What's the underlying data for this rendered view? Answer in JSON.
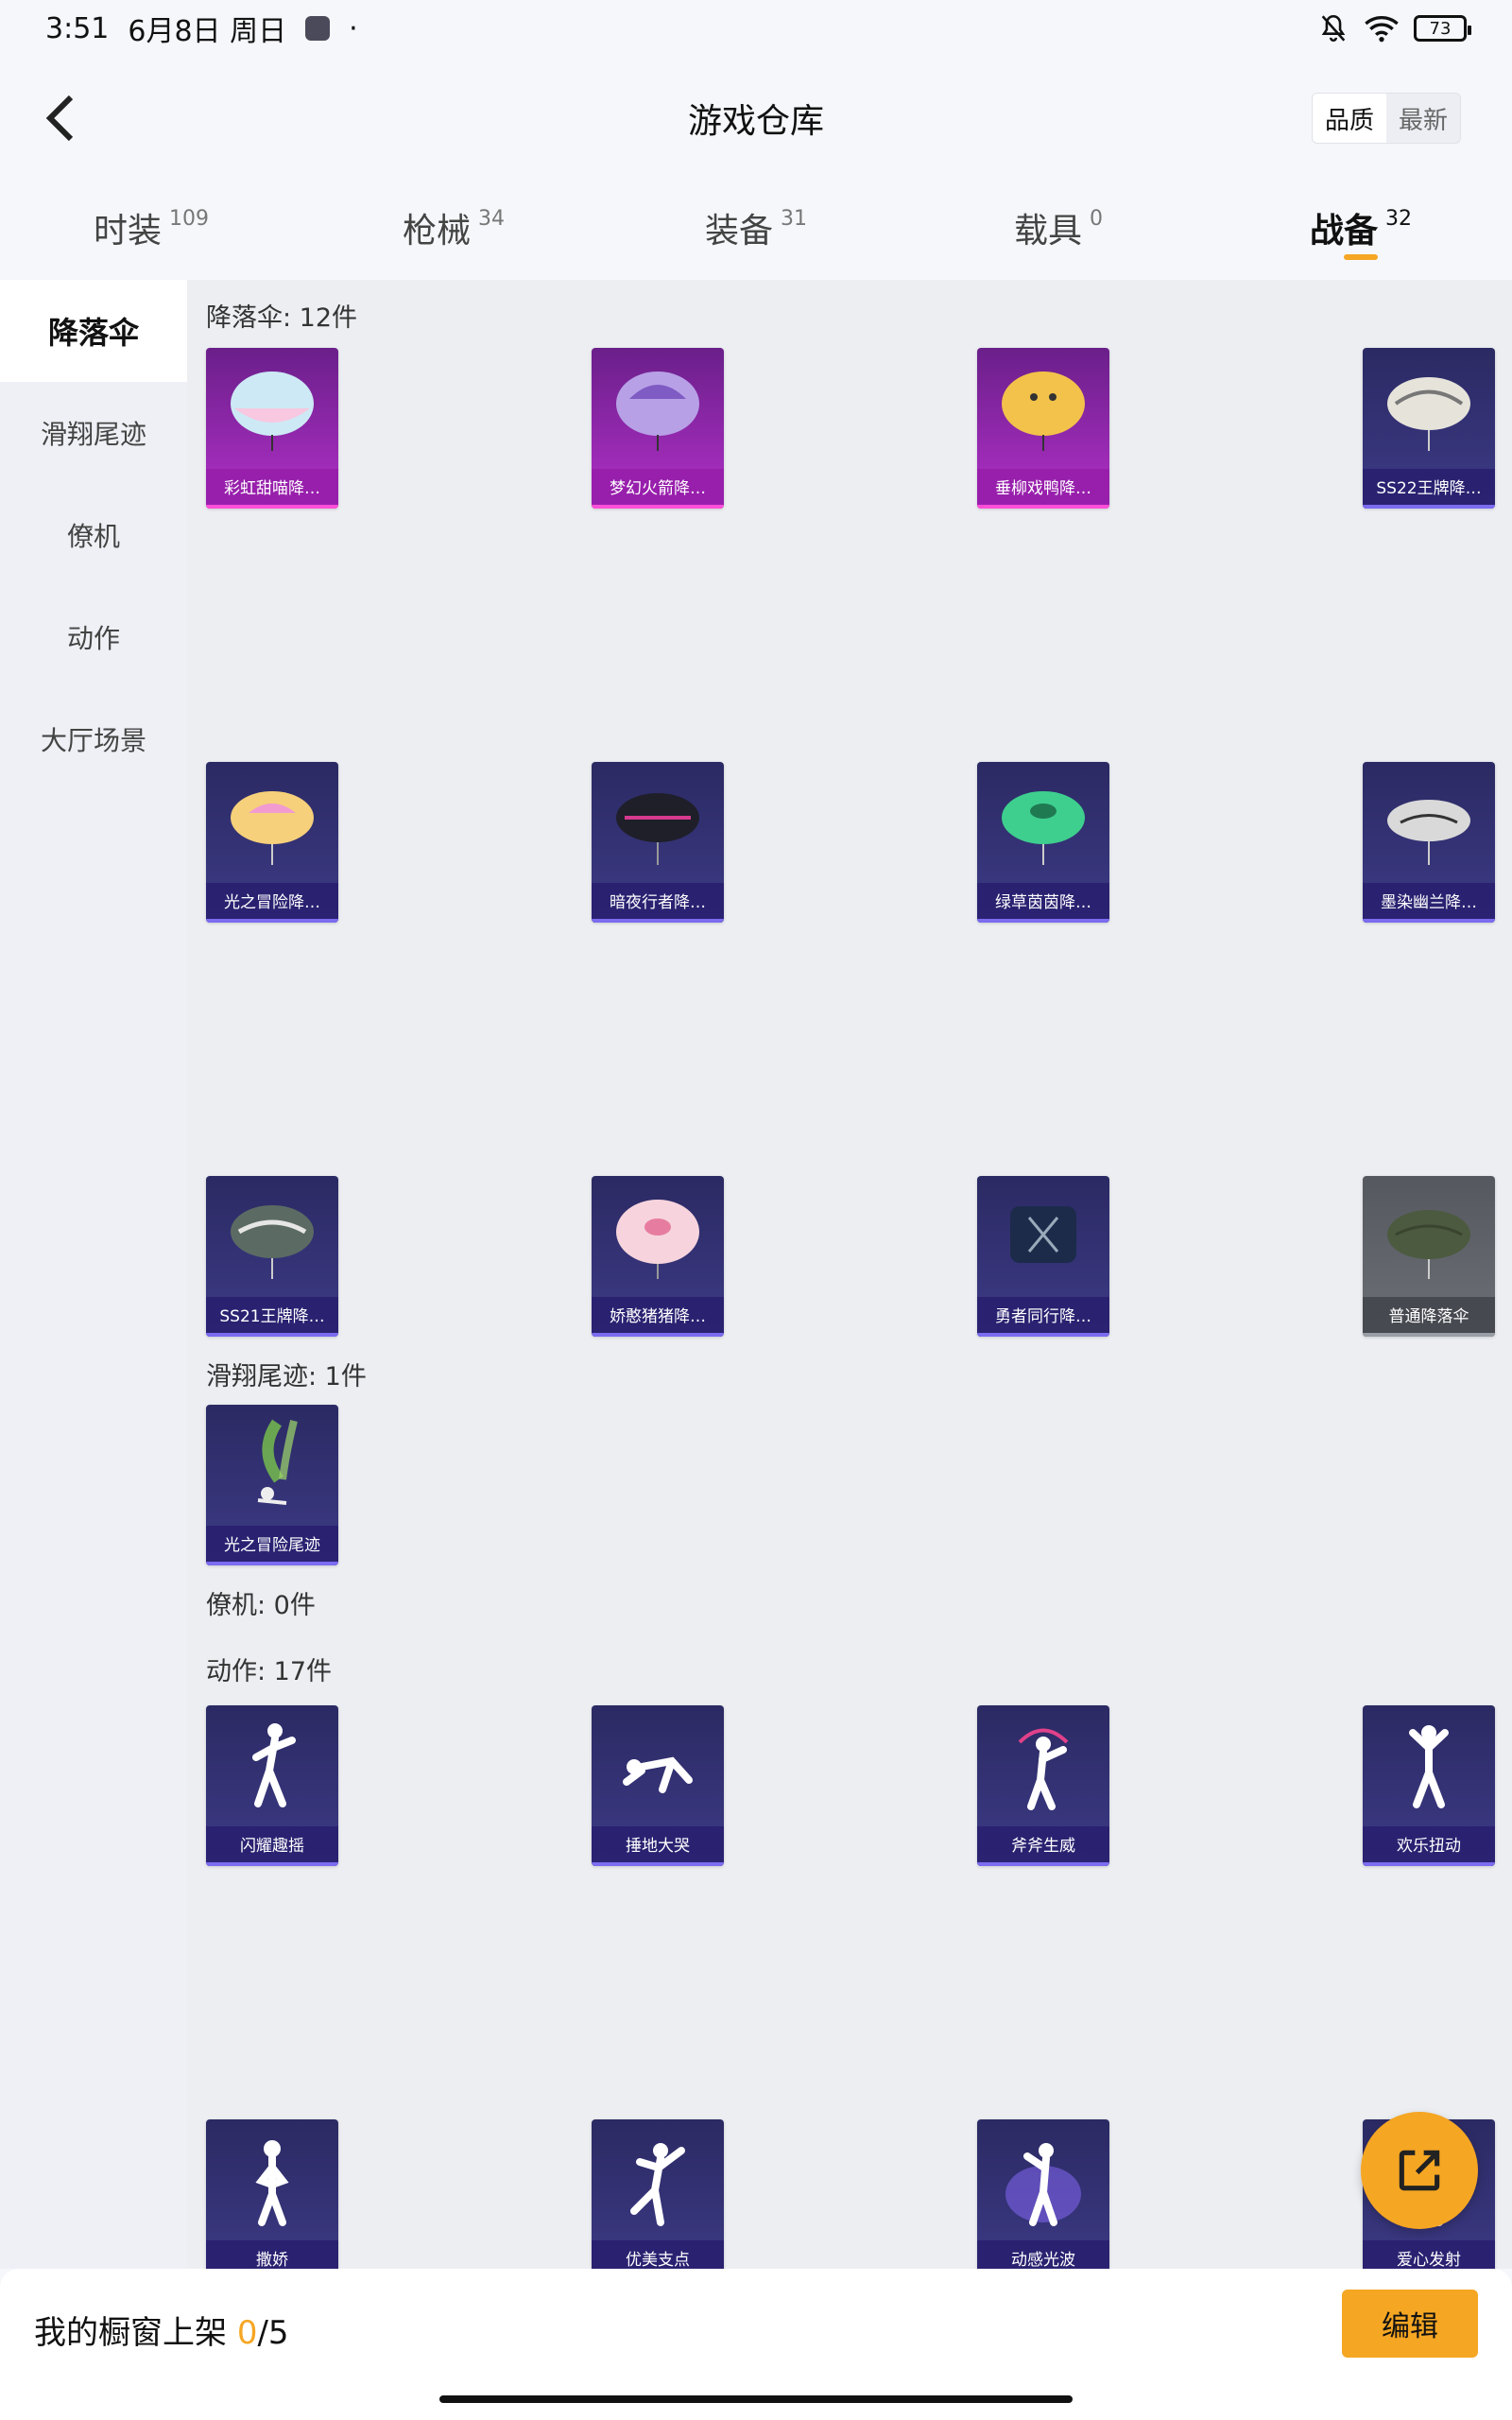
{
  "status": {
    "time": "3:51",
    "date": "6月8日 周日",
    "battery": "73"
  },
  "header": {
    "title": "游戏仓库",
    "sort_options": [
      "品质",
      "最新"
    ],
    "active_sort": "品质"
  },
  "tabs": [
    {
      "label": "时装",
      "count": "109"
    },
    {
      "label": "枪械",
      "count": "34"
    },
    {
      "label": "装备",
      "count": "31"
    },
    {
      "label": "载具",
      "count": "0"
    },
    {
      "label": "战备",
      "count": "32"
    }
  ],
  "sidebar": {
    "items": [
      "降落伞",
      "滑翔尾迹",
      "僚机",
      "动作",
      "大厅场景"
    ],
    "active": "降落伞"
  },
  "sections": {
    "parachute": {
      "title": "降落伞: 12件",
      "items": [
        "彩虹甜喵降…",
        "梦幻火箭降…",
        "垂柳戏鸭降…",
        "SS22王牌降…",
        "光之冒险降…",
        "暗夜行者降…",
        "绿草茵茵降…",
        "墨染幽兰降…",
        "SS21王牌降…",
        "娇憨猪猪降…",
        "勇者同行降…",
        "普通降落伞"
      ]
    },
    "trail": {
      "title": "滑翔尾迹: 1件",
      "items": [
        "光之冒险尾迹"
      ]
    },
    "wingman": {
      "title": "僚机: 0件"
    },
    "emote": {
      "title": "动作: 17件",
      "items": [
        "闪耀趣摇",
        "捶地大哭",
        "斧斧生威",
        "欢乐扭动",
        "撒娇",
        "优美支点",
        "动感光波",
        "爱心发射"
      ]
    }
  },
  "bottom": {
    "showcase_label": "我的橱窗上架 ",
    "showcase_current": "0",
    "showcase_total": "/5",
    "edit_label": "编辑"
  },
  "colors": {
    "accent": "#f5a623",
    "card_blue": "#2b2a63",
    "card_purple": "#b230c8"
  }
}
